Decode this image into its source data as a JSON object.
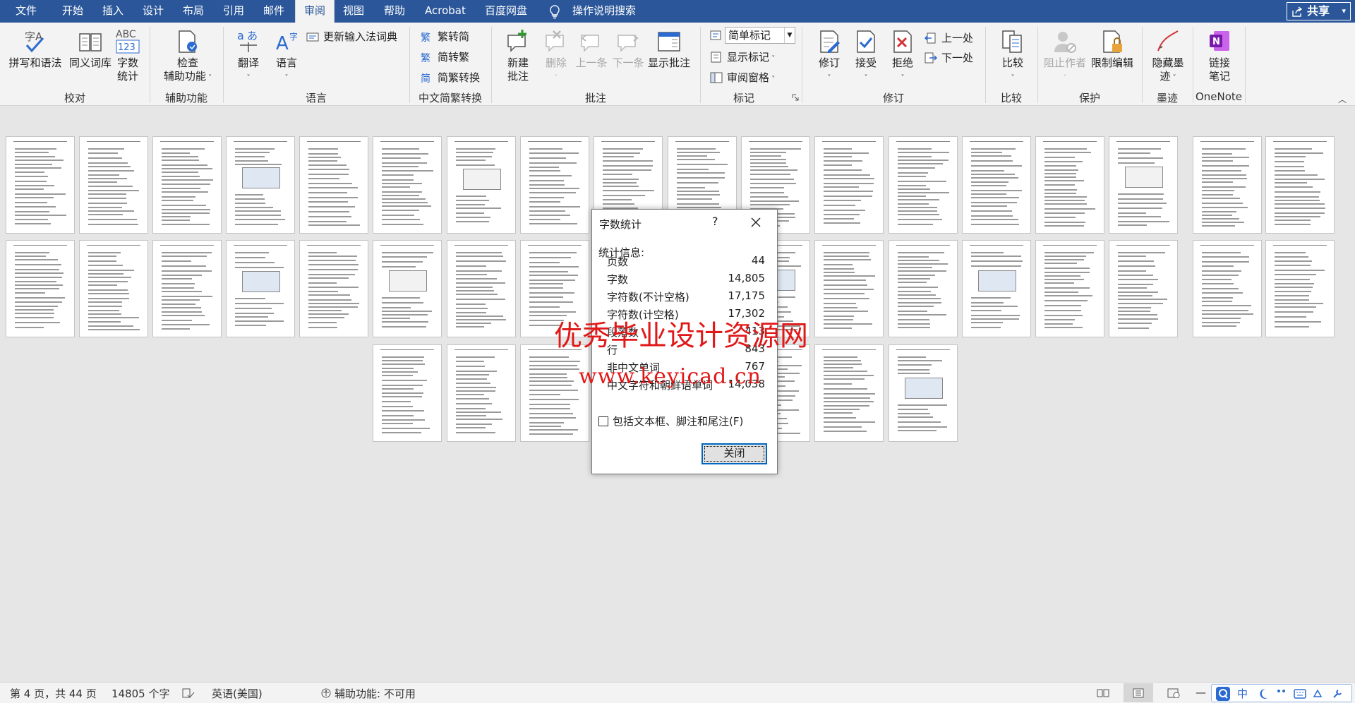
{
  "tabs": [
    "文件",
    "开始",
    "插入",
    "设计",
    "布局",
    "引用",
    "邮件",
    "审阅",
    "视图",
    "帮助",
    "Acrobat",
    "百度网盘"
  ],
  "active_tab": "审阅",
  "tell_me": "操作说明搜索",
  "share": "共享",
  "ribbon": {
    "proofing": {
      "spelling": "拼写和语法",
      "thesaurus": "同义词库",
      "wordcount_l1": "字数",
      "wordcount_l2": "统计",
      "abc_icon": "ABC",
      "abc_num": "123",
      "label": "校对"
    },
    "accessibility": {
      "check_l1": "检查",
      "check_l2": "辅助功能",
      "label": "辅助功能"
    },
    "language": {
      "translate": "翻译",
      "language": "语言",
      "update_ime": "更新输入法词典",
      "label": "语言"
    },
    "chinese": {
      "to_simplified": "繁转简",
      "to_traditional": "简转繁",
      "convert": "简繁转换",
      "label": "中文简繁转换"
    },
    "comments": {
      "new_l1": "新建",
      "new_l2": "批注",
      "delete": "删除",
      "previous": "上一条",
      "next": "下一条",
      "show": "显示批注",
      "label": "批注"
    },
    "tracking": {
      "markup": "简单标记",
      "show_markup": "显示标记",
      "pane": "审阅窗格",
      "label": "标记"
    },
    "changes": {
      "track": "修订",
      "accept": "接受",
      "reject": "拒绝",
      "previous": "上一处",
      "next": "下一处",
      "label": "修订"
    },
    "compare": {
      "compare": "比较",
      "label": "比较"
    },
    "protect": {
      "block": "阻止作者",
      "restrict": "限制编辑",
      "label": "保护"
    },
    "ink": {
      "hide_l1": "隐藏墨",
      "hide_l2": "迹",
      "label": "墨迹"
    },
    "onenote": {
      "link_l1": "链接",
      "link_l2": "笔记",
      "label": "OneNote"
    }
  },
  "watermark": {
    "line1": "优秀毕业设计资源网",
    "line2": "www.keyicad.cn"
  },
  "dialog": {
    "title": "字数统计",
    "help": "?",
    "stats_header": "统计信息:",
    "stats": [
      {
        "key": "页数",
        "value": "44"
      },
      {
        "key": "字数",
        "value": "14,805"
      },
      {
        "key": "字符数(不计空格)",
        "value": "17,175"
      },
      {
        "key": "字符数(计空格)",
        "value": "17,302"
      },
      {
        "key": "段落数",
        "value": "413"
      },
      {
        "key": "行",
        "value": "843"
      },
      {
        "key": "非中文单词",
        "value": "767"
      },
      {
        "key": "中文字符和朝鲜语单词",
        "value": "14,038"
      }
    ],
    "include_label": "包括文本框、脚注和尾注(F)",
    "close": "关闭"
  },
  "status": {
    "page": "第 4 页，共 44 页",
    "words": "14805 个字",
    "language": "英语(美国)",
    "accessibility": "辅助功能: 不可用"
  },
  "ime": {
    "mode": "中"
  },
  "colors": {
    "accent": "#2b579a",
    "watermark": "#e01818",
    "dialog_focus": "#0067c0"
  }
}
